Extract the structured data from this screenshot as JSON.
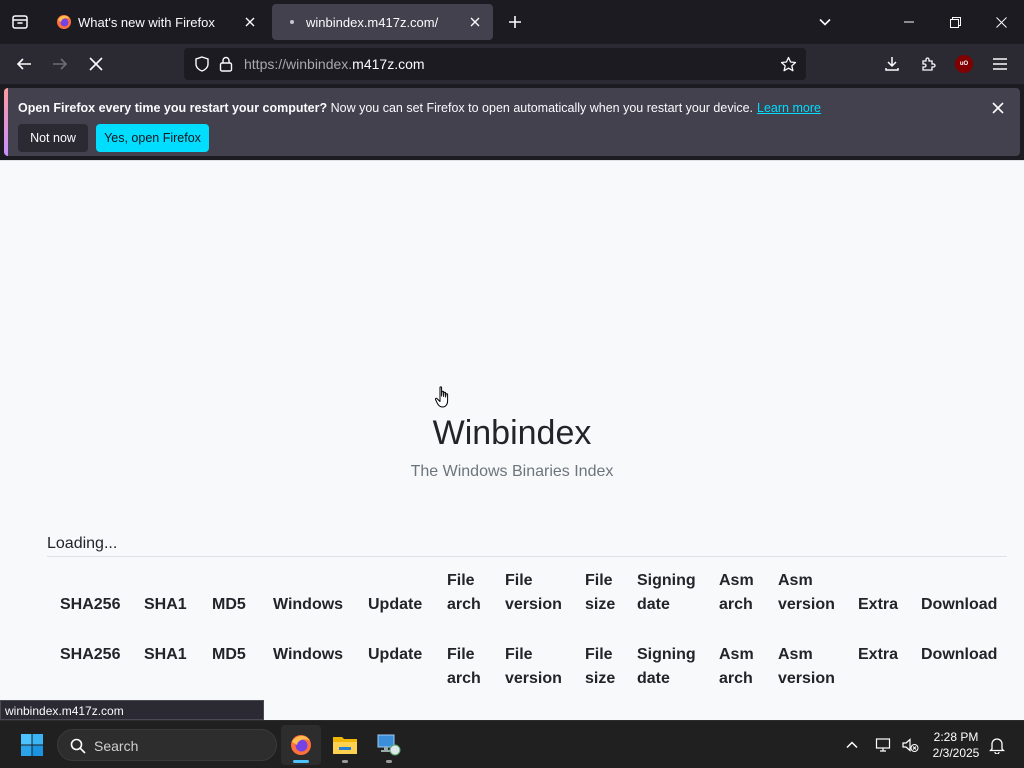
{
  "browser": {
    "tabs": [
      {
        "title": "What's new with Firefox",
        "state": "inactive"
      },
      {
        "title": "winbindex.m417z.com/",
        "state": "active-loading"
      }
    ],
    "url": {
      "prefix": "https://winbindex.",
      "domain": "m417z.com"
    },
    "extension_badge": "uO"
  },
  "notification": {
    "bold_text": "Open Firefox every time you restart your computer?",
    "text": " Now you can set Firefox to open automatically when you restart your device.",
    "link": "Learn more",
    "buttons": {
      "not_now": "Not now",
      "yes": "Yes, open Firefox"
    }
  },
  "page": {
    "title": "Winbindex",
    "subtitle": "The Windows Binaries Index",
    "loading": "Loading...",
    "columns": [
      "SHA256",
      "SHA1",
      "MD5",
      "Windows",
      "Update",
      "File\narch",
      "File\nversion",
      "File\nsize",
      "Signing\ndate",
      "Asm\narch",
      "Asm\nversion",
      "Extra",
      "Download"
    ]
  },
  "status_bar": "winbindex.m417z.com",
  "taskbar": {
    "search_placeholder": "Search",
    "time": "2:28 PM",
    "date": "2/3/2025"
  },
  "colors": {
    "accent": "#00ddff",
    "tab_active": "#42414d",
    "chrome_dark": "#1c1b22"
  }
}
